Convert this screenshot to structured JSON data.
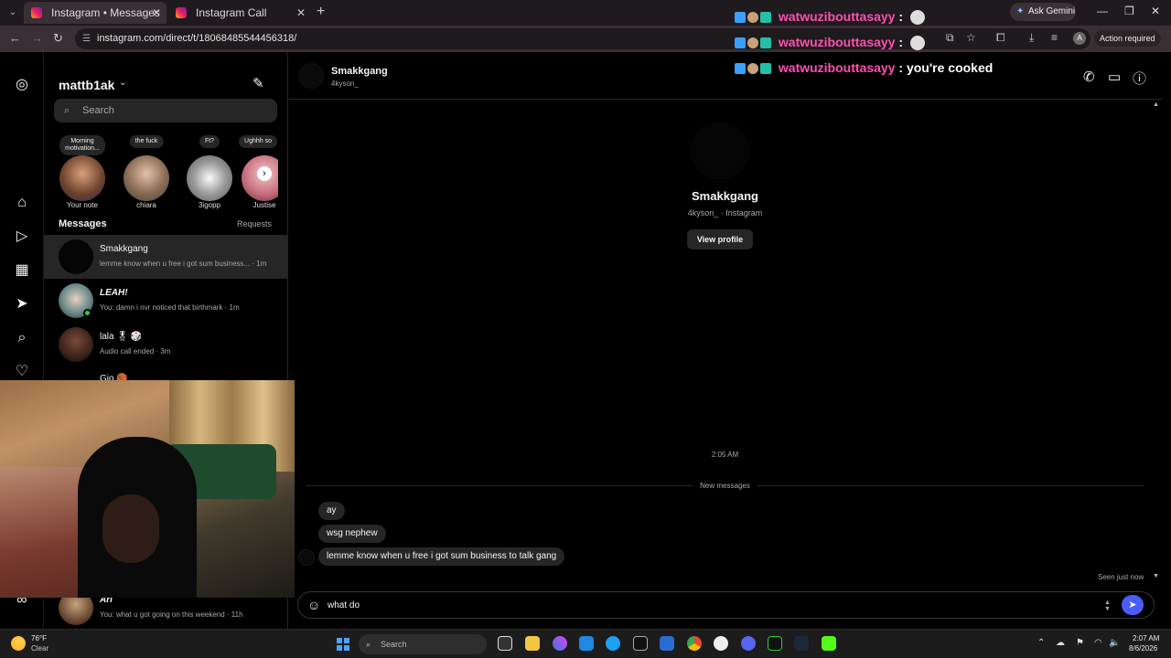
{
  "browser": {
    "tabs": [
      {
        "title": "Instagram • Messages",
        "active": true
      },
      {
        "title": "Instagram Call",
        "active": false
      }
    ],
    "new_tab": "+",
    "ask_gemini": "Ask Gemini",
    "url": "instagram.com/direct/t/18068485544456318/",
    "action_required": "Action required",
    "profile_initial": "A"
  },
  "stream_chat": [
    {
      "user": "watwuzibouttasayy",
      "sep": " :",
      "message": ""
    },
    {
      "user": "watwuzibouttasayy",
      "sep": " :",
      "message": ""
    },
    {
      "user": "watwuzibouttasayy",
      "sep": " :",
      "message": "you're cooked"
    }
  ],
  "inbox": {
    "username": "mattb1ak",
    "search_placeholder": "Search",
    "notes": [
      {
        "bubble": "Morning\nmotivation...",
        "name": "Your note"
      },
      {
        "bubble": "the fuck",
        "name": "chiara"
      },
      {
        "bubble": "Ft?",
        "name": "3igopp"
      },
      {
        "bubble": "Ughhh so",
        "name": "Justise"
      }
    ],
    "messages_label": "Messages",
    "requests_label": "Requests",
    "conversations": [
      {
        "name": "Smakkgang",
        "preview": "lemme know when u free i got sum business... · 1m"
      },
      {
        "name": "LEAH!",
        "preview": "You: damn i nvr noticed that birthmark · 1m"
      },
      {
        "name": "lala 🎖 🎲",
        "preview": "Audio call ended · 3m"
      },
      {
        "name": "Gio 🏀 ...",
        "preview": ""
      },
      {
        "name": "Ari",
        "preview": "You: what u got going on this weekend · 11h"
      }
    ]
  },
  "chat": {
    "header_name": "Smakkgang",
    "header_handle": "4kyson_",
    "profile_name": "Smakkgang",
    "profile_sub": "4kyson_ · Instagram",
    "view_profile": "View profile",
    "timestamp": "2:05 AM",
    "new_messages": "New messages",
    "messages": [
      "ay",
      "wsg nephew",
      "lemme know when u free i got sum business to talk gang"
    ],
    "seen": "Seen just now",
    "composer_value": "what do "
  },
  "taskbar": {
    "weather_temp": "76°F",
    "weather_cond": "Clear",
    "search": "Search",
    "time": "2:07 AM",
    "date": "8/6/2026"
  },
  "colors": {
    "accent_send": "#4a5df9",
    "stream_user": "#ff4fb2",
    "online": "#2ecc40"
  }
}
